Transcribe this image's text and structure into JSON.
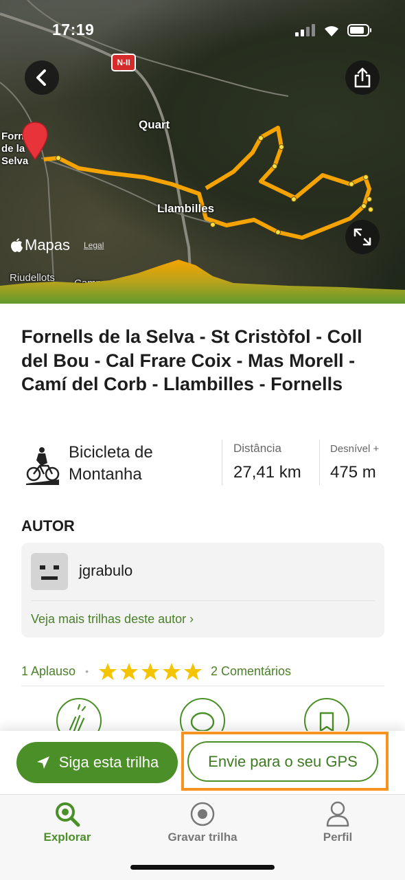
{
  "status_bar": {
    "time": "17:19"
  },
  "map": {
    "road_badge": "N-II",
    "places": {
      "quart": "Quart",
      "llambilles": "Llambilles",
      "fornells": "Fornells de la Selva",
      "riudellots": "Riudellots",
      "campllong": "Camp"
    },
    "maps_brand": "Mapas",
    "legal": "Legal",
    "icons": {
      "back": "chevron-left-icon",
      "share": "share-icon",
      "expand": "expand-icon",
      "pin": "map-pin-icon"
    },
    "route_color": "#f5a300"
  },
  "trail": {
    "title": "Fornells de la Selva - St Cristòfol - Coll del Bou - Cal Frare Coix - Mas Morell - Camí del Corb - Llambilles - Fornells",
    "activity": "Bicicleta de Montanha",
    "distance_label": "Distância",
    "distance_value": "27,41 km",
    "elevation_label": "Desnível +",
    "elevation_value": "475 m"
  },
  "author": {
    "heading": "AUTOR",
    "name": "jgrabulo",
    "more_link": "Veja mais trilhas deste autor ›"
  },
  "social": {
    "applause": "1 Aplauso",
    "dot": "•",
    "stars": 5,
    "comments": "2 Comentários"
  },
  "actions": {
    "follow": "Siga esta trilha",
    "send_gps": "Envie para o seu GPS"
  },
  "tabs": [
    {
      "label": "Explorar",
      "icon": "search-icon",
      "active": true
    },
    {
      "label": "Gravar trilha",
      "icon": "record-icon",
      "active": false
    },
    {
      "label": "Perfil",
      "icon": "profile-icon",
      "active": false
    }
  ],
  "colors": {
    "brand_green": "#4a8f27",
    "highlight_orange": "#f7931e",
    "star": "#f5c400"
  }
}
